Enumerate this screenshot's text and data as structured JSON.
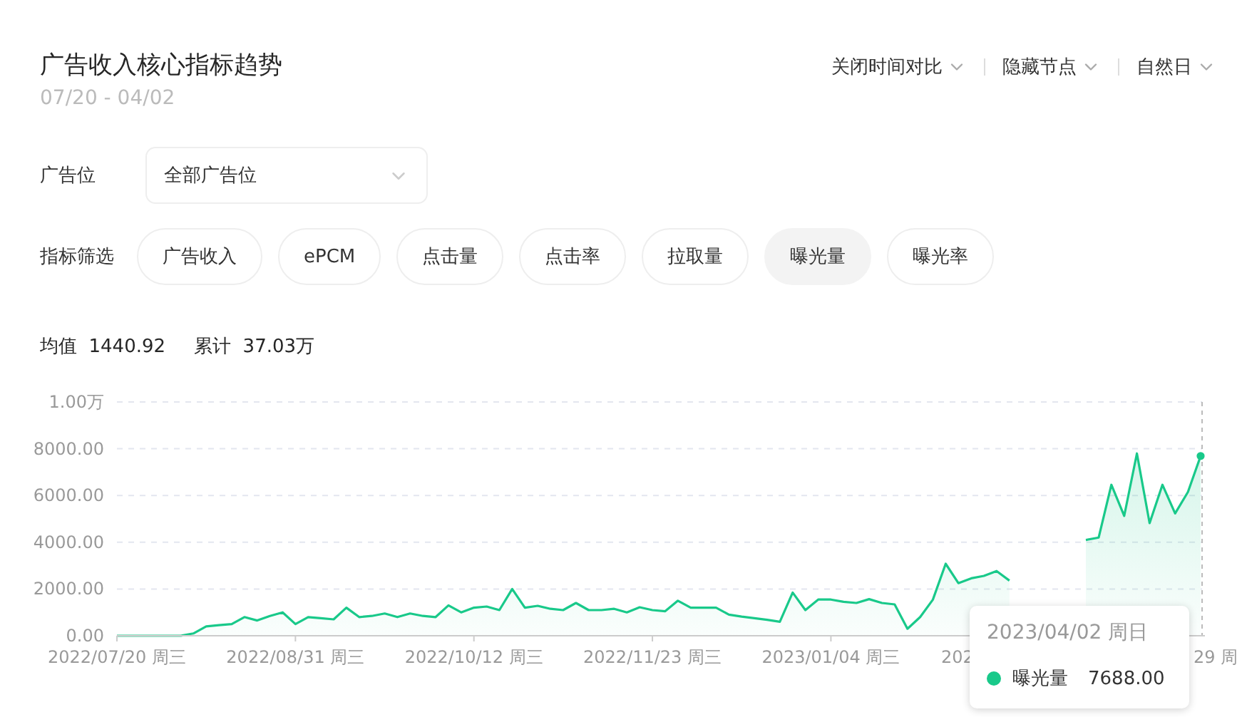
{
  "header": {
    "title": "广告收入核心指标趋势",
    "date_range": "07/20 - 04/02"
  },
  "controls": [
    {
      "label": "关闭时间对比"
    },
    {
      "label": "隐藏节点"
    },
    {
      "label": "自然日"
    }
  ],
  "ad_slot": {
    "label": "广告位",
    "value": "全部广告位"
  },
  "metrics_filter": {
    "label": "指标筛选",
    "options": [
      {
        "label": "广告收入",
        "selected": false
      },
      {
        "label": "ePCM",
        "selected": false
      },
      {
        "label": "点击量",
        "selected": false
      },
      {
        "label": "点击率",
        "selected": false
      },
      {
        "label": "拉取量",
        "selected": false
      },
      {
        "label": "曝光量",
        "selected": true
      },
      {
        "label": "曝光率",
        "selected": false
      }
    ]
  },
  "stats": [
    {
      "label": "均值",
      "value": "1440.92"
    },
    {
      "label": "累计",
      "value": "37.03万"
    }
  ],
  "chart": {
    "top_tick_label": "1.00万",
    "partly_hidden_axis_labels": [
      "202",
      "29 周"
    ],
    "chart_data": {
      "type": "area",
      "ylim": [
        0,
        10000
      ],
      "categories": [
        "2022/07/20 周三",
        null,
        null,
        null,
        null,
        null,
        null,
        null,
        null,
        null,
        null,
        null,
        null,
        null,
        "2022/08/31 周三",
        null,
        null,
        null,
        null,
        null,
        null,
        null,
        null,
        null,
        null,
        null,
        null,
        null,
        "2022/10/12 周三",
        null,
        null,
        null,
        null,
        null,
        null,
        null,
        null,
        null,
        null,
        null,
        null,
        null,
        "2022/11/23 周三",
        null,
        null,
        null,
        null,
        null,
        null,
        null,
        null,
        null,
        null,
        null,
        null,
        null,
        "2023/01/04 周三",
        null,
        null,
        null,
        null,
        null,
        null,
        null,
        null,
        null,
        null,
        null,
        null,
        null,
        null,
        null,
        null,
        null,
        null,
        null,
        null,
        null,
        null,
        null,
        null,
        null,
        null,
        null,
        null,
        null
      ],
      "series": [
        {
          "name": "曝光量",
          "color": "#19c98a",
          "values": [
            0,
            0,
            0,
            0,
            0,
            0,
            100,
            400,
            450,
            500,
            800,
            650,
            850,
            1000,
            500,
            800,
            750,
            700,
            1200,
            800,
            850,
            950,
            800,
            950,
            850,
            800,
            1300,
            1000,
            1200,
            1250,
            1100,
            2000,
            1200,
            1280,
            1150,
            1100,
            1400,
            1100,
            1100,
            1150,
            1000,
            1220,
            1100,
            1050,
            1500,
            1200,
            1200,
            1200,
            900,
            820,
            750,
            680,
            600,
            1850,
            1100,
            1550,
            1550,
            1450,
            1400,
            1570,
            1400,
            1340,
            300,
            800,
            1540,
            3080,
            2250,
            2460,
            2560,
            2770,
            2360,
            null,
            null,
            null,
            null,
            null,
            4100,
            4200,
            6460,
            5130,
            7800,
            4820,
            6460,
            5230,
            6150,
            7690
          ]
        }
      ],
      "grid": true,
      "yticks": [
        {
          "value": 0,
          "label": "0.00"
        },
        {
          "value": 2000,
          "label": "2000.00"
        },
        {
          "value": 4000,
          "label": "4000.00"
        },
        {
          "value": 6000,
          "label": "6000.00"
        },
        {
          "value": 8000,
          "label": "8000.00"
        }
      ]
    },
    "tooltip": {
      "date": "2023/04/02 周日",
      "value": "7688.00"
    }
  }
}
